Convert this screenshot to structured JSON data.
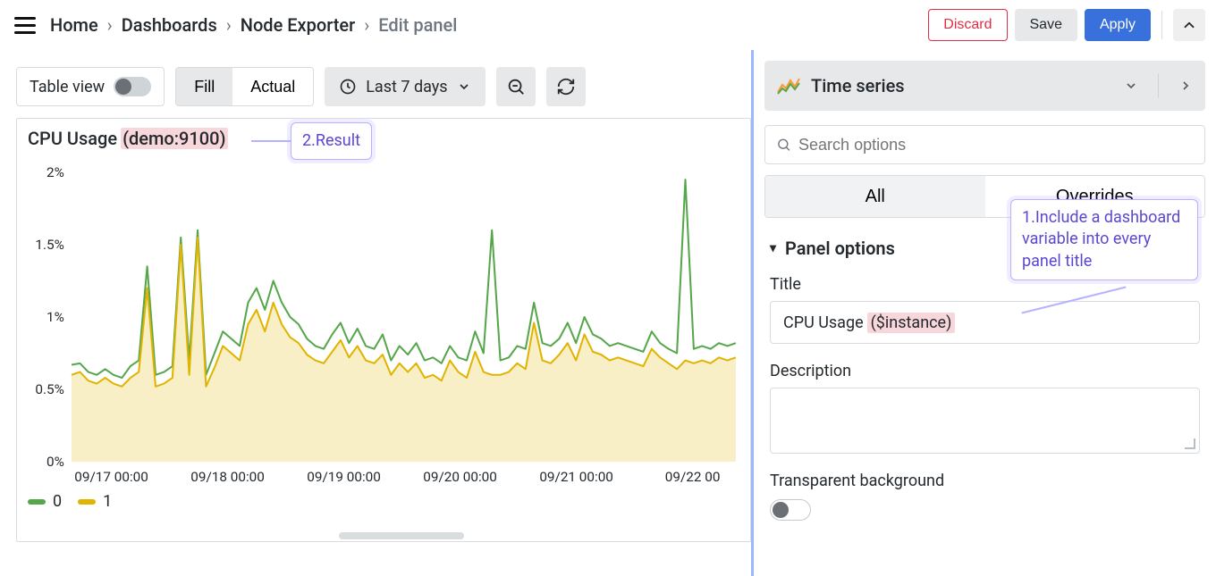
{
  "breadcrumbs": {
    "items": [
      "Home",
      "Dashboards",
      "Node Exporter"
    ],
    "current": "Edit panel"
  },
  "actions": {
    "discard": "Discard",
    "save": "Save",
    "apply": "Apply"
  },
  "ltoolbar": {
    "table_view": "Table view",
    "fill": "Fill",
    "actual": "Actual",
    "timerange": "Last 7 days"
  },
  "panel": {
    "title_prefix": "CPU Usage ",
    "title_suffix_hl": "(demo:9100)",
    "legend": [
      "0",
      "1"
    ]
  },
  "annotations": {
    "result": "2.Result",
    "tip": "1.Include a dashboard variable into every panel title"
  },
  "right": {
    "viz_name": "Time series",
    "search_ph": "Search options",
    "tab_all": "All",
    "tab_over": "Overrides",
    "section": "Panel options",
    "title_label": "Title",
    "title_prefix": "CPU Usage ",
    "title_hl": "($instance)",
    "desc_label": "Description",
    "transparent_label": "Transparent background"
  },
  "chart_data": {
    "type": "line",
    "title": "CPU Usage (demo:9100)",
    "xlabel": "",
    "ylabel": "",
    "ylim": [
      0,
      2
    ],
    "y_ticks": [
      0,
      0.5,
      1.0,
      1.5,
      2.0
    ],
    "y_tick_labels": [
      "0%",
      "0.5%",
      "1%",
      "1.5%",
      "2%"
    ],
    "x_tick_labels": [
      "09/17 00:00",
      "09/18 00:00",
      "09/19 00:00",
      "09/20 00:00",
      "09/21 00:00",
      "09/22 00"
    ],
    "x_points": [
      0,
      1,
      2,
      3,
      4,
      5,
      6,
      7,
      8,
      9,
      10,
      11,
      12,
      13,
      14,
      15,
      16,
      17,
      18,
      19,
      20,
      21,
      22,
      23,
      24,
      25,
      26,
      27,
      28,
      29,
      30,
      31,
      32,
      33,
      34,
      35,
      36,
      37,
      38,
      39,
      40,
      41,
      42,
      43,
      44,
      45,
      46,
      47,
      48,
      49,
      50,
      51,
      52,
      53,
      54,
      55,
      56,
      57,
      58,
      59,
      60,
      61,
      62,
      63,
      64,
      65,
      66,
      67,
      68,
      69,
      70,
      71,
      72,
      73,
      74,
      75,
      76,
      77,
      78,
      79
    ],
    "series": [
      {
        "name": "0",
        "color": "#56a64b",
        "values": [
          0.67,
          0.68,
          0.62,
          0.6,
          0.64,
          0.6,
          0.58,
          0.66,
          0.7,
          1.35,
          0.6,
          0.62,
          0.66,
          1.55,
          0.7,
          1.6,
          0.6,
          0.75,
          0.9,
          0.85,
          0.8,
          1.1,
          1.2,
          1.05,
          1.25,
          1.1,
          1.0,
          0.95,
          0.85,
          0.8,
          0.78,
          0.88,
          0.96,
          0.82,
          0.92,
          0.8,
          0.78,
          0.88,
          0.7,
          0.8,
          0.74,
          0.82,
          0.7,
          0.72,
          0.68,
          0.8,
          0.72,
          0.7,
          0.9,
          0.75,
          1.6,
          0.7,
          0.72,
          0.8,
          0.78,
          1.1,
          0.82,
          0.8,
          0.85,
          0.96,
          0.82,
          1.0,
          0.88,
          0.85,
          0.8,
          0.82,
          0.8,
          0.78,
          0.76,
          0.9,
          0.82,
          0.78,
          0.75,
          1.95,
          0.78,
          0.8,
          0.78,
          0.82,
          0.8,
          0.82
        ]
      },
      {
        "name": "1",
        "color": "#e0b400",
        "values": [
          0.6,
          0.62,
          0.56,
          0.54,
          0.58,
          0.54,
          0.52,
          0.58,
          0.62,
          1.2,
          0.52,
          0.54,
          0.58,
          1.5,
          0.6,
          1.55,
          0.52,
          0.65,
          0.8,
          0.75,
          0.7,
          0.95,
          1.05,
          0.9,
          1.1,
          0.95,
          0.86,
          0.82,
          0.74,
          0.7,
          0.68,
          0.76,
          0.84,
          0.72,
          0.8,
          0.7,
          0.68,
          0.74,
          0.6,
          0.68,
          0.62,
          0.68,
          0.58,
          0.6,
          0.56,
          0.7,
          0.62,
          0.58,
          0.76,
          0.62,
          0.6,
          0.6,
          0.62,
          0.68,
          0.64,
          0.96,
          0.7,
          0.68,
          0.74,
          0.82,
          0.7,
          0.88,
          0.76,
          0.74,
          0.7,
          0.72,
          0.7,
          0.68,
          0.66,
          0.78,
          0.72,
          0.68,
          0.64,
          0.7,
          0.68,
          0.7,
          0.68,
          0.72,
          0.7,
          0.72
        ]
      }
    ]
  }
}
